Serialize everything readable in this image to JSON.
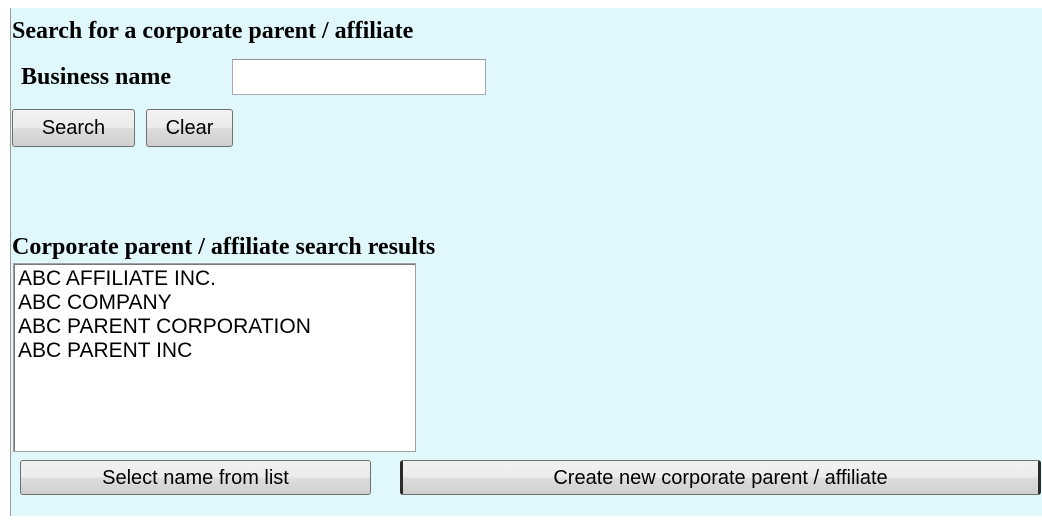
{
  "search_section": {
    "heading": "Search for a corporate parent / affiliate",
    "business_name_label": "Business name",
    "business_name_value": "",
    "search_button": "Search",
    "clear_button": "Clear"
  },
  "results_section": {
    "heading": "Corporate parent / affiliate search results",
    "items": [
      "ABC AFFILIATE INC.",
      "ABC COMPANY",
      "ABC PARENT CORPORATION",
      "ABC PARENT INC"
    ],
    "select_button": "Select name from list",
    "create_button": "Create new corporate parent / affiliate"
  }
}
